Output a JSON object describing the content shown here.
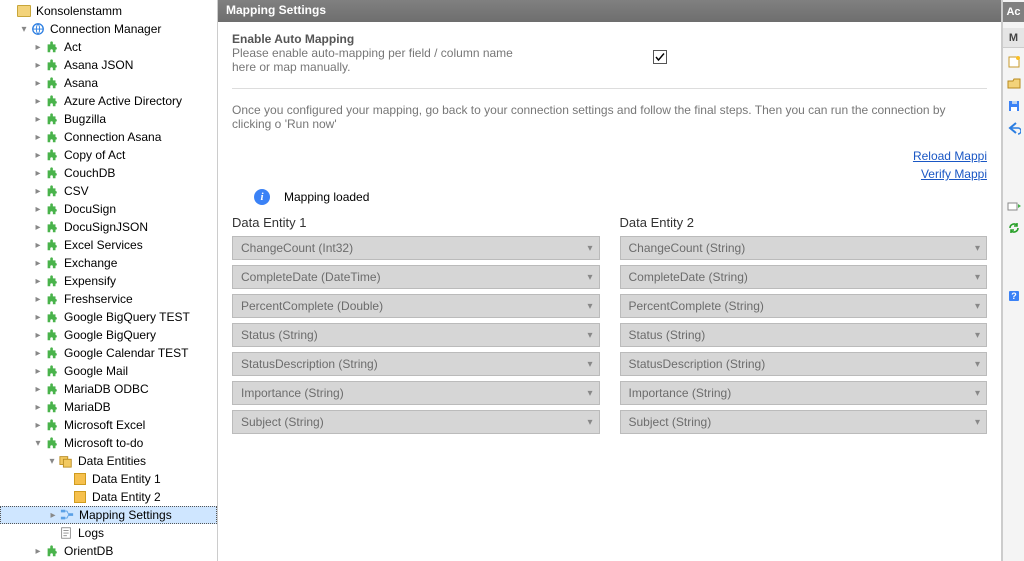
{
  "tree": {
    "root": "Konsolenstamm",
    "cm": "Connection Manager",
    "items": [
      "Act",
      "Asana JSON",
      "Asana",
      "Azure Active Directory",
      "Bugzilla",
      "Connection Asana",
      "Copy of Act",
      "CouchDB",
      "CSV",
      "DocuSign",
      "DocuSignJSON",
      "Excel Services",
      "Exchange",
      "Expensify",
      "Freshservice",
      "Google BigQuery TEST",
      "Google BigQuery",
      "Google Calendar TEST",
      "Google Mail",
      "MariaDB ODBC",
      "MariaDB",
      "Microsoft Excel"
    ],
    "todo": "Microsoft to-do",
    "dataEntities": "Data Entities",
    "de1": "Data Entity 1",
    "de2": "Data Entity 2",
    "mapping": "Mapping Settings",
    "logs": "Logs",
    "orient": "OrientDB"
  },
  "panel": {
    "title": "Mapping Settings",
    "enableHead": "Enable Auto Mapping",
    "enableSub1": "Please enable auto-mapping per field / column name",
    "enableSub2": "here or map manually.",
    "checked": true,
    "infoText": "Once you configured your mapping, go back to your connection settings and follow the final steps. Then you can run the connection by clicking o 'Run now'",
    "link1": "Reload Mappi",
    "link2": "Verify Mappi",
    "loaded": "Mapping loaded",
    "ent1": "Data Entity 1",
    "ent2": "Data Entity 2",
    "col1": [
      "ChangeCount (Int32)",
      "CompleteDate (DateTime)",
      "PercentComplete (Double)",
      "Status (String)",
      "StatusDescription (String)",
      "Importance (String)",
      "Subject (String)"
    ],
    "col2": [
      "ChangeCount (String)",
      "CompleteDate (String)",
      "PercentComplete (String)",
      "Status (String)",
      "StatusDescription (String)",
      "Importance (String)",
      "Subject (String)"
    ]
  },
  "rightbar": {
    "tab1": "Ac",
    "tab2": "M"
  }
}
